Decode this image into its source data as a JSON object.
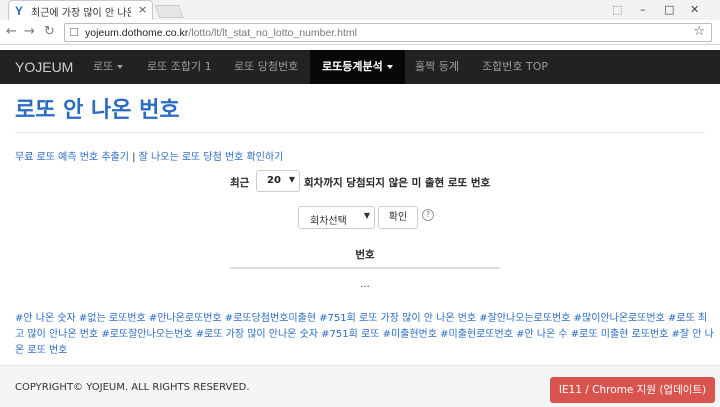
{
  "browser": {
    "tab_title": "최근에 가장 많이 안 나온",
    "tab_favicon": "Y",
    "url_host": "yojeum.dothome.co.kr",
    "url_path": "/lotto/lt/lt_stat_no_lotto_number.html"
  },
  "icons": {
    "back": "←",
    "forward": "→",
    "reload": "↻",
    "page": "☐",
    "star": "☆",
    "close": "×",
    "minimize": "–",
    "maximize": "□",
    "window_close": "✕",
    "user": "⬚"
  },
  "navbar": {
    "brand": "YOJEUM",
    "items": [
      {
        "label": "로또",
        "dropdown": true,
        "active": false
      },
      {
        "label": "로또 조합기 1",
        "dropdown": false,
        "active": false
      },
      {
        "label": "로또 당첨번호",
        "dropdown": false,
        "active": false
      },
      {
        "label": "로또등계분석",
        "dropdown": true,
        "active": true
      },
      {
        "label": "홀짝 등계",
        "dropdown": false,
        "active": false
      },
      {
        "label": "조합번호 TOP",
        "dropdown": false,
        "active": false
      }
    ]
  },
  "main": {
    "title": "로또 안 나온 번호",
    "link1": "무료 로또 예측 번호 추출기",
    "separator": "|",
    "link2": "잘 나오는 로또 당첨 번호 확인하기",
    "filter_prefix": "최근",
    "recent_value": "20",
    "filter_suffix": "회차까지 당첨되지 않은 미 출현 로또 번호",
    "round_select": "회차선택",
    "confirm_label": "확인",
    "help": "?",
    "column_header": "번호",
    "cell_value": "...",
    "tags": "#안 나온 숫자 #없는 로또번호 #안나온로또번호 #로또당첨번호미출현 #751회 로또 가장 많이 안 나온 번호 #잘안나오는로또번호 #많이안나온로또번호 #로또 최고 많이 안나온 번호 #로또잘안나오는번호 #로또 가장 많이 안나온 숫자 #751회 로또 #미출현번호 #미출현로또번호 #안 나온 수 #로또 미출현 로또번호 #잘 안 나온 로또 번호"
  },
  "footer": {
    "copyright": "COPYRIGHT© YOJEUM. ALL RIGHTS RESERVED.",
    "ie_button": "IE11 / Chrome 지원 (업데이트)"
  },
  "colors": {
    "link_blue": "#2a6cc4",
    "navbar_bg": "#222222",
    "navbar_active_bg": "#080808",
    "button_danger": "#d9534f"
  }
}
